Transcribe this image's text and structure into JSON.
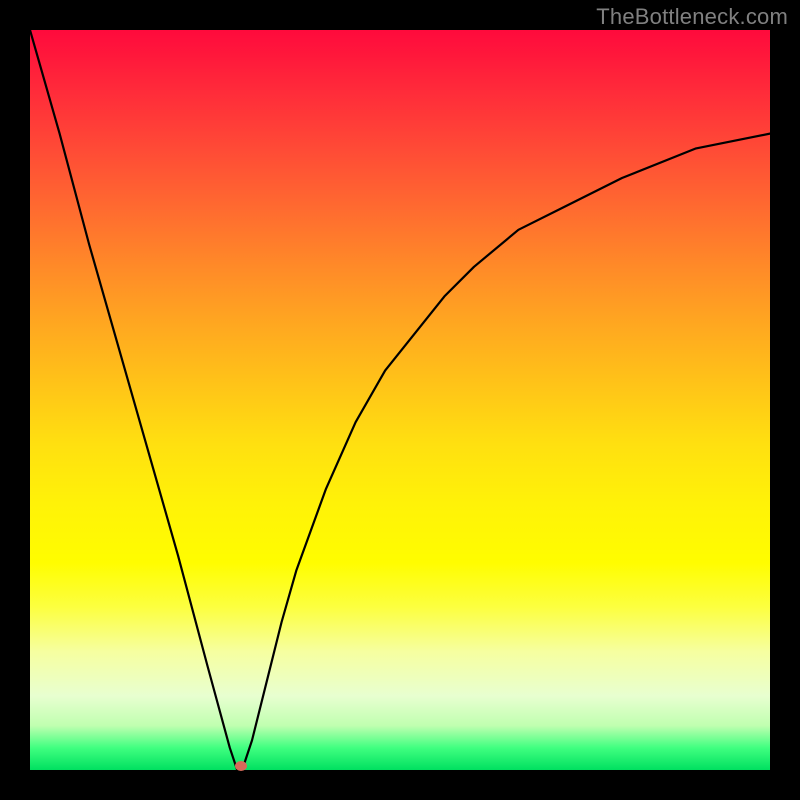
{
  "watermark": "TheBottleneck.com",
  "background": {
    "gradient_top": "#ff0a3c",
    "gradient_bottom": "#00e060",
    "frame_color": "#000000"
  },
  "chart_data": {
    "type": "line",
    "title": "",
    "xlabel": "",
    "ylabel": "",
    "xlim": [
      0,
      100
    ],
    "ylim": [
      0,
      100
    ],
    "grid": false,
    "legend": false,
    "description": "V-shaped bottleneck curve: steep linear descent from top-left to a minimum near x≈28, then asymptotic rise toward the right. Lower values (green) indicate less bottleneck; higher values (red) indicate more.",
    "series": [
      {
        "name": "bottleneck-curve",
        "color": "#000000",
        "x": [
          0,
          4,
          8,
          12,
          16,
          20,
          24,
          27,
          28,
          29,
          30,
          32,
          34,
          36,
          40,
          44,
          48,
          52,
          56,
          60,
          66,
          72,
          80,
          90,
          100
        ],
        "y": [
          100,
          86,
          71,
          57,
          43,
          29,
          14,
          3,
          0,
          1,
          4,
          12,
          20,
          27,
          38,
          47,
          54,
          59,
          64,
          68,
          73,
          76,
          80,
          84,
          86
        ]
      }
    ],
    "marker": {
      "x": 28.5,
      "y": 0.5,
      "color": "#d66a5a"
    }
  }
}
